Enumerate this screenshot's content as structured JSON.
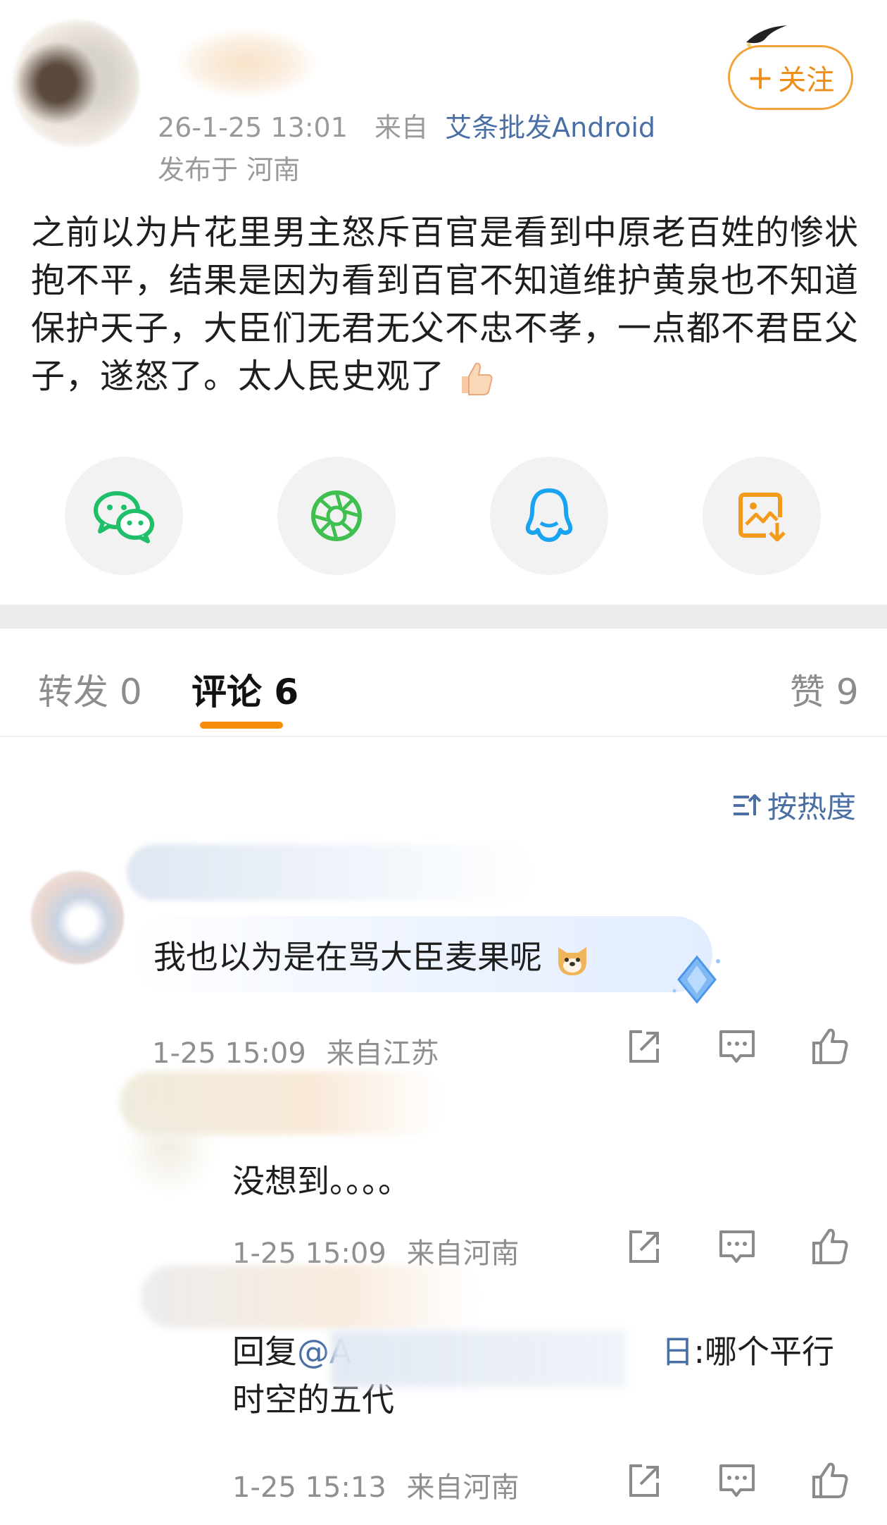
{
  "post": {
    "timestamp": "26-1-25 13:01",
    "source_prefix": "来自",
    "source": "艾条批发Android",
    "location": "发布于 河南",
    "follow_label": "关注",
    "follow_plus": "+",
    "text": "之前以为片花里男主怒斥百官是看到中原老百姓的惨状抱不平，结果是因为看到百官不知道维护黄泉也不知道保护天子，大臣们无君无父不忠不孝，一点都不君臣父子，遂怒了。太人民史观了",
    "thumb_emoji": "thumbs-up-icon"
  },
  "share": {
    "items": [
      "wechat-icon",
      "moments-icon",
      "qq-icon",
      "save-image-icon"
    ]
  },
  "tabs": {
    "repost": "转发 0",
    "comments": "评论 6",
    "likes": "赞 9"
  },
  "sort": {
    "label": "按热度"
  },
  "comments": [
    {
      "text": "我也以为是在骂大臣麦果呢",
      "emoji": "dog-icon",
      "time": "1-25 15:09",
      "location": "来自江苏"
    },
    {
      "text": "没想到。。。。",
      "time": "1-25 15:09",
      "location": "来自河南"
    },
    {
      "reply_prefix": "回复",
      "mention_start": "@A",
      "mention_end": "日",
      "text": ":哪个平行时空的五代",
      "time": "1-25 15:13",
      "location": "来自河南"
    }
  ],
  "colors": {
    "accent_orange": "#f58d0a",
    "link_blue": "#4a6fa5",
    "follow_orange": "#f08d19"
  }
}
